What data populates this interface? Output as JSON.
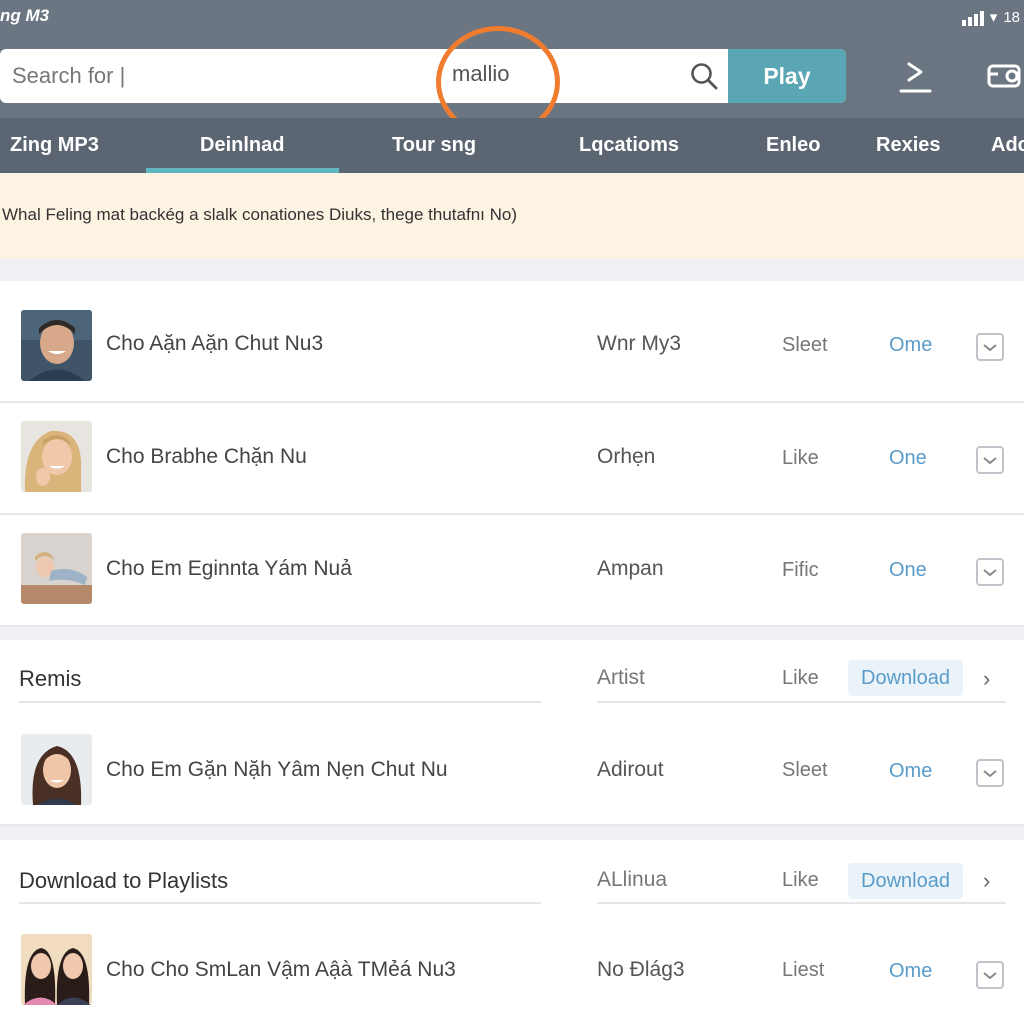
{
  "app": {
    "tag": "ng M3"
  },
  "status": {
    "battery": "18"
  },
  "search": {
    "placeholder": "Search for |",
    "query": "mallio",
    "play_label": "Play"
  },
  "tabs": [
    {
      "label": "Zing MP3"
    },
    {
      "label": "Deinlnad"
    },
    {
      "label": "Tour sng"
    },
    {
      "label": "Lqcatioms"
    },
    {
      "label": "Enleo"
    },
    {
      "label": "Rexies"
    },
    {
      "label": "Adc"
    }
  ],
  "banner": {
    "text": "Whal Feling mat backég a slalk conationes Diuks, thege thutafnı No)"
  },
  "rows": [
    {
      "title": "Cho Aặn Aặn Chut Nu3",
      "artist": "Wnr My3",
      "like": "Sleet",
      "action": "Ome"
    },
    {
      "title": "Cho Brabhe Chặn Nu",
      "artist": "Orhẹn",
      "like": "Like",
      "action": "One"
    },
    {
      "title": "Cho Em Eginnta Yám Nuả",
      "artist": "Ampan",
      "like": "Fific",
      "action": "One"
    }
  ],
  "section1": {
    "title": "Remis",
    "artist": "Artist",
    "like": "Like",
    "action": "Download"
  },
  "row4": {
    "title": "Cho Em Gặn Nặh Yâm Nẹn Chut Nu",
    "artist": "Adirout",
    "like": "Sleet",
    "action": "Ome"
  },
  "section2": {
    "title": "Download to Playlists",
    "artist": "ALlinua",
    "like": "Like",
    "action": "Download"
  },
  "row5": {
    "title": "Cho Cho SmLan Vậm Aậà TMẻá Nu3",
    "artist": "No Đlág3",
    "like": "Liest",
    "action": "Ome"
  },
  "colors": {
    "topbar": "#6c7683",
    "nav": "#5c6672",
    "accent": "#5aa6b4",
    "highlight_ring": "#f07d2f",
    "link": "#5a9bc9"
  }
}
